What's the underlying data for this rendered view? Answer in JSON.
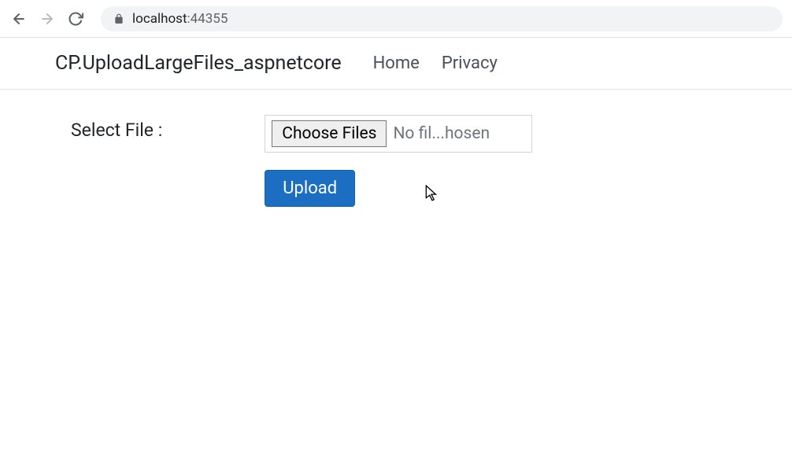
{
  "browser": {
    "url_host": "localhost",
    "url_port": ":44355"
  },
  "navbar": {
    "brand": "CP.UploadLargeFiles_aspnetcore",
    "links": {
      "home": "Home",
      "privacy": "Privacy"
    }
  },
  "form": {
    "label": "Select File :",
    "choose_files_label": "Choose Files",
    "file_status": "No fil...hosen",
    "upload_label": "Upload"
  }
}
